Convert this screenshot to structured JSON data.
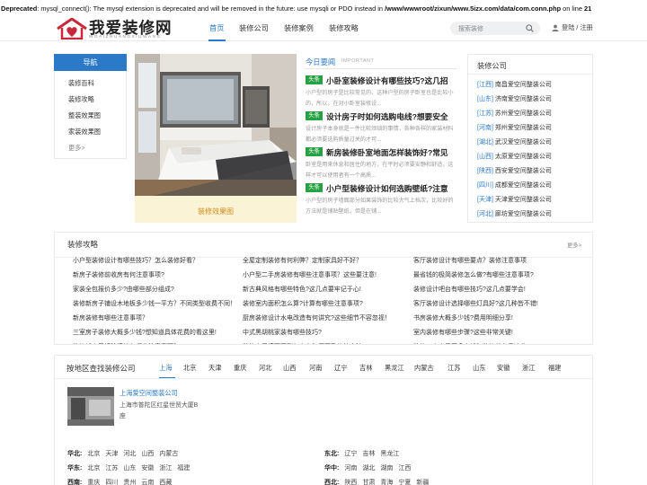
{
  "deprecation": {
    "label": "Deprecated",
    "message": ": mysql_connect(): The mysql extension is deprecated and will be removed in the future: use mysqli or PDO instead in ",
    "path": "/www/wwwroot/zixun/www.5izx.com/data/com.conn.php",
    "suffix": " on line ",
    "line": "21"
  },
  "header": {
    "logo_cn": "我爱装修网",
    "logo_en": "WOAIZHUANGXIUWANG",
    "nav": [
      "首页",
      "装修公司",
      "装修案例",
      "装修攻略"
    ],
    "search_placeholder": "搜索装修",
    "login": "登陆 / 注册"
  },
  "sidebar": {
    "title": "导航",
    "items": [
      "装修百科",
      "装修攻略",
      "整装效果图",
      "家装效果图",
      "更多>"
    ]
  },
  "feature": {
    "caption": "装修效果图"
  },
  "today": {
    "title": "今日要闻",
    "subtitle": "IMPORTANT",
    "items": [
      {
        "tag": "头条",
        "title": "小卧室装修设计有哪些技巧?这几招",
        "desc": "小户型的房子是比较常见的，这种户型的房子卧室也是比较小的，所以，在对小卧室装修设..."
      },
      {
        "tag": "头条",
        "title": "设计房子时如何选购电线?想要安全",
        "desc": "设计房子本身就是一件比较烦琐的事情，各种各样的家装材料都必须要选购质量过关的才可..."
      },
      {
        "tag": "头条",
        "title": "新房装修卧室地面怎样装饰好?常见",
        "desc": "卧室是用来休息和居住的地方，在平时必须要安静和舒适，这样才可以使用者有一个高质..."
      },
      {
        "tag": "头条",
        "title": "小户型装修设计如何选购壁纸?注意",
        "desc": "小户型的房子墙面部分如果装饰的比较大气上档次，比较好的方法就是铺贴壁纸，但是在铺..."
      }
    ]
  },
  "companies": {
    "title": "装修公司",
    "rows": [
      {
        "region": "[江西]",
        "name": "南昌爱空间整装公司"
      },
      {
        "region": "[山东]",
        "name": "济南爱空间整装公司"
      },
      {
        "region": "[江苏]",
        "name": "苏州爱空间整装公司"
      },
      {
        "region": "[河南]",
        "name": "郑州爱空间整装公司"
      },
      {
        "region": "[湖北]",
        "name": "武汉爱空间整装公司"
      },
      {
        "region": "[山西]",
        "name": "太原爱空间整装公司"
      },
      {
        "region": "[陕西]",
        "name": "西安爱空间整装公司"
      },
      {
        "region": "[四川]",
        "name": "成都爱空间整装公司"
      },
      {
        "region": "[天津]",
        "name": "天津爱空间整装公司"
      },
      {
        "region": "[河北]",
        "name": "廊坊爱空间整装公司"
      }
    ]
  },
  "strategy": {
    "title": "装修攻略",
    "more": "更多>",
    "columns": [
      [
        "小户型装修设计有哪些技巧？怎么装修好看？",
        "新房子装修前收房有何注意事项?",
        "家装全包报价多少?由哪些部分组成?",
        "装修新房子铺设木地板多少钱一平方？不同类型收费不同！",
        "新房装修有哪些注意事项？",
        "三室房子装修大概多少钱?想知道具体花费的看这里!",
        "装修新房子拆除墙体有哪些注意事项？"
      ],
      [
        "全屋定制装修有何利弊？定制家具好不好？",
        "小户型二手房装修有哪些注意事项？这些要注意!",
        "新古典风格有哪些特色?这几点要牢记于心!",
        "装修室内面积怎么算?计算有哪些注意事项?",
        "厨房装修设计水电改造有何讲究?这些细节不容忽视！",
        "中式黑胡桃家装有哪些技巧?",
        "装修房子墙面开裂怎么办？原因及修补方法"
      ],
      [
        "客厅装修设计有哪些要点？装修注意事项",
        "最省钱的极简装修怎么做?有哪些注意事项?",
        "装修设计吧台有哪些技巧?这几点要学会!",
        "客厅装修设计选择哪些灯具好?这几种皆不错!",
        "书房装修大概多少钱?费用明细分享!",
        "室内装修有哪些步骤?这些非常关键!",
        "装修一套房子要多少钱？装修前必看这些"
      ]
    ]
  },
  "area": {
    "title": "按地区查找装修公司",
    "tabs": [
      "上海",
      "北京",
      "天津",
      "重庆",
      "河北",
      "山西",
      "河南",
      "辽宁",
      "吉林",
      "黑龙江",
      "内蒙古",
      "江苏",
      "山东",
      "安徽",
      "浙江",
      "福建"
    ],
    "company_name": "上海爱空间整装公司",
    "company_address": "上海市普陀区红星世贸大厦B座",
    "regions": [
      {
        "name": "华北:",
        "places": [
          "北京",
          "天津",
          "河北",
          "山西",
          "内蒙古"
        ]
      },
      {
        "name": "东北:",
        "places": [
          "辽宁",
          "吉林",
          "黑龙江"
        ]
      },
      {
        "name": "华东:",
        "places": [
          "北京",
          "江苏",
          "山东",
          "安徽",
          "浙江",
          "福建"
        ]
      },
      {
        "name": "华中:",
        "places": [
          "河南",
          "湖北",
          "湖南",
          "江西"
        ]
      },
      {
        "name": "西南:",
        "places": [
          "重庆",
          "四川",
          "贵州",
          "云南",
          "西藏"
        ]
      },
      {
        "name": "西北:",
        "places": [
          "陕西",
          "甘肃",
          "青海",
          "宁夏",
          "新疆"
        ]
      }
    ]
  },
  "colors": {
    "accent": "#2a7ac8",
    "tag_green": "#27a243",
    "caption_bg": "#fbf3d5",
    "caption_text": "#d58a1b"
  }
}
